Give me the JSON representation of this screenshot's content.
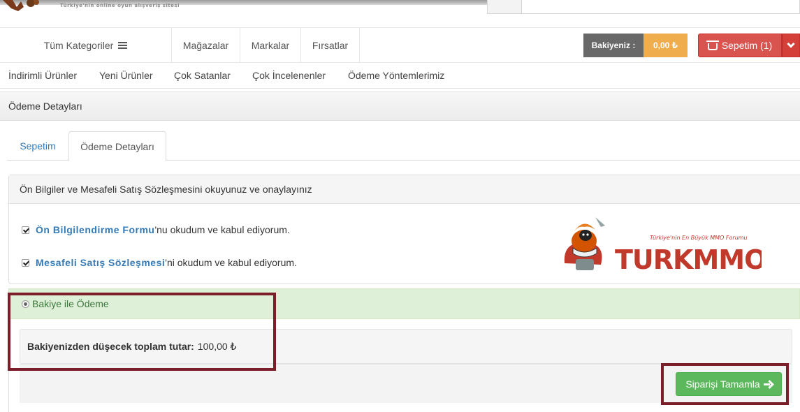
{
  "header": {
    "tagline": "Türkiye'nin online oyun alışveriş sitesi"
  },
  "nav": {
    "all_categories": "Tüm Kategoriler",
    "links": [
      "Mağazalar",
      "Markalar",
      "Fırsatlar"
    ],
    "balance_label": "Bakiyeniz :",
    "balance_value": "0,00 ₺",
    "cart_label": "Sepetim (1)"
  },
  "subnav": {
    "links": [
      "İndirimli Ürünler",
      "Yeni Ürünler",
      "Çok Satanlar",
      "Çok İncelenenler",
      "Ödeme Yöntemlerimiz"
    ]
  },
  "page": {
    "title": "Ödeme Detayları"
  },
  "tabs": [
    {
      "label": "Sepetim",
      "active": false
    },
    {
      "label": "Ödeme Detayları",
      "active": true
    }
  ],
  "agreement": {
    "heading": "Ön Bilgiler ve Mesafeli Satış Sözleşmesini okuyunuz ve onaylayınız",
    "items": [
      {
        "link": "Ön Bilgilendirme Formu",
        "suffix": "'nu okudum ve kabul ediyorum.",
        "checked": true
      },
      {
        "link": "Mesafeli Satış Sözleşmesi",
        "suffix": "'ni okudum ve kabul ediyorum.",
        "checked": true
      }
    ]
  },
  "brand_logo": {
    "tagline": "Türkiye'nin En Büyük MMO Forumu",
    "wordmark": "TURKMMO"
  },
  "payment": {
    "method_label": "Bakiye ile Ödeme",
    "total_label": "Bakiyenizden düşecek toplam tutar:",
    "total_value": "100,00 ₺",
    "complete_button": "Siparişi Tamamla"
  },
  "colors": {
    "highlight": "#7a1e2a",
    "success": "#5cb85c",
    "danger": "#d9534f",
    "warning": "#f0ad4e",
    "link": "#337ab7"
  }
}
